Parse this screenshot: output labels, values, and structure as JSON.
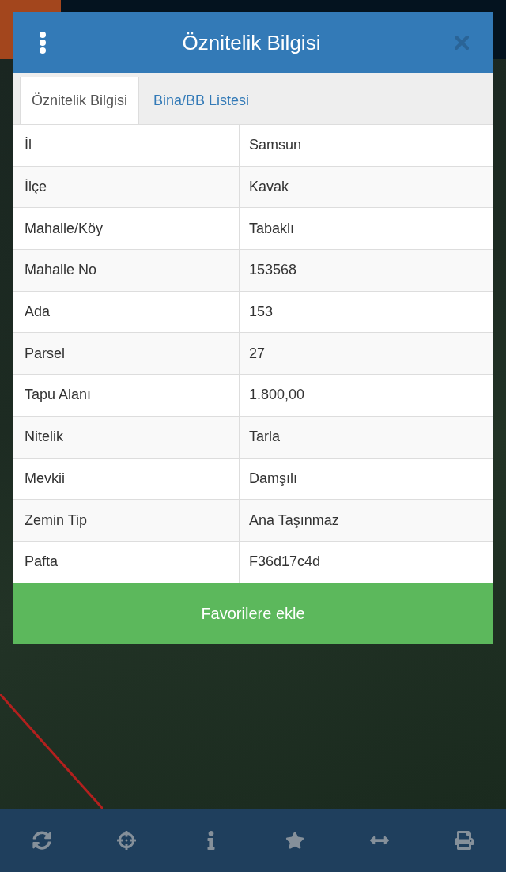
{
  "dialog": {
    "title": "Öznitelik Bilgisi"
  },
  "tabs": [
    {
      "label": "Öznitelik Bilgisi",
      "selected": true
    },
    {
      "label": "Bina/BB Listesi",
      "selected": false
    }
  ],
  "attributes": [
    {
      "name": "İl",
      "value": "Samsun"
    },
    {
      "name": "İlçe",
      "value": "Kavak"
    },
    {
      "name": "Mahalle/Köy",
      "value": "Tabaklı"
    },
    {
      "name": "Mahalle No",
      "value": "153568"
    },
    {
      "name": "Ada",
      "value": "153"
    },
    {
      "name": "Parsel",
      "value": "27"
    },
    {
      "name": "Tapu Alanı",
      "value": "1.800,00"
    },
    {
      "name": "Nitelik",
      "value": "Tarla"
    },
    {
      "name": "Mevkii",
      "value": "Damşılı"
    },
    {
      "name": "Zemin Tip",
      "value": "Ana Taşınmaz"
    },
    {
      "name": "Pafta",
      "value": "F36d17c4d"
    }
  ],
  "action_button": "Favorilere ekle"
}
